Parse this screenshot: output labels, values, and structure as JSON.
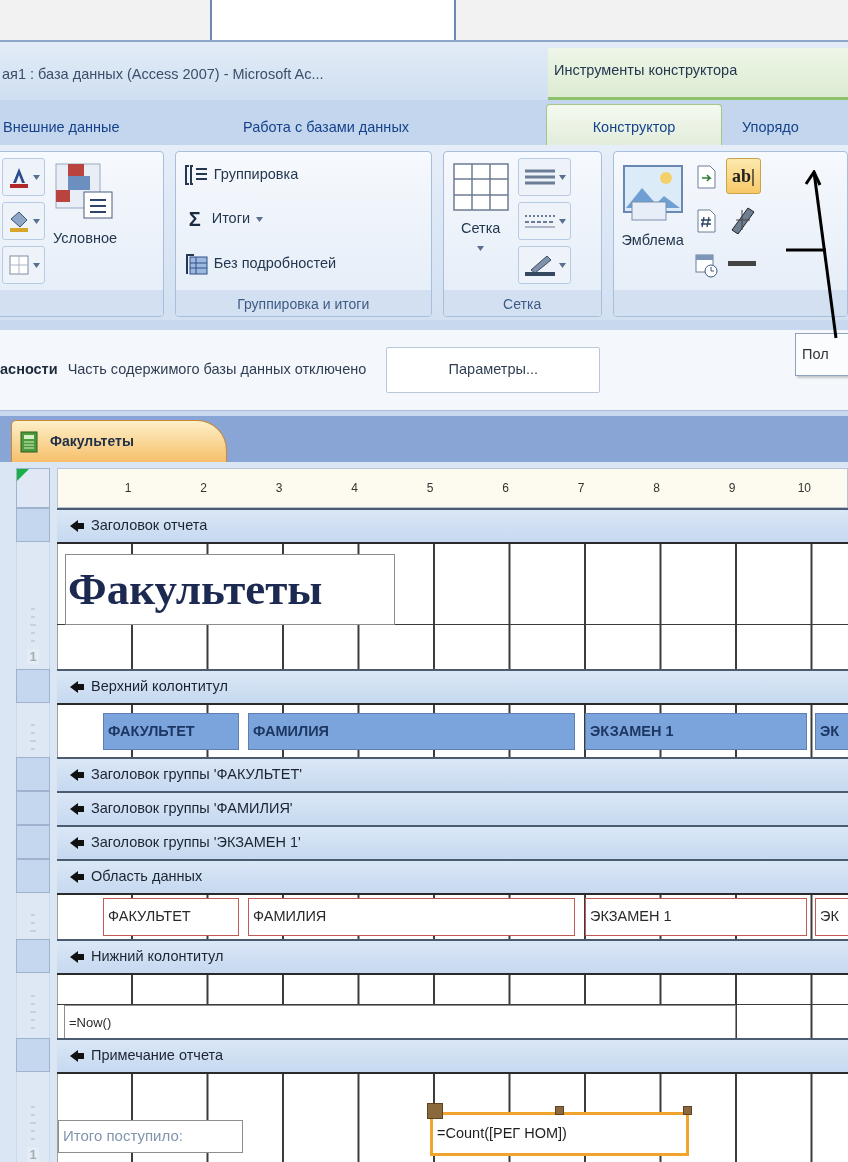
{
  "window": {
    "title": "ая1 : база данных (Access 2007) - Microsoft Ac..."
  },
  "context_header": {
    "label": "Инструменты конструктора"
  },
  "ribbon_tabs": [
    {
      "label": "Внешние данные",
      "selected": false
    },
    {
      "label": "Работа с базами данных",
      "selected": false
    },
    {
      "label": "Конструктор",
      "selected": true
    },
    {
      "label": "Упорядо",
      "selected": false
    }
  ],
  "ribbon_groups": [
    {
      "columns": [
        [
          {
            "kind": "icon-dropdown"
          },
          {
            "kind": "icon-dropdown"
          },
          {
            "kind": "icon-dropdown"
          }
        ],
        [
          {
            "kind": "large",
            "label": "Условное"
          }
        ]
      ]
    },
    {
      "label": "Группировка и итоги",
      "columns": [
        [
          {
            "kind": "small",
            "label": "Группировка"
          },
          {
            "kind": "small",
            "glyph": "Σ",
            "label": "Итоги",
            "dropdown": true
          },
          {
            "kind": "small",
            "label": "Без подробностей"
          }
        ]
      ]
    },
    {
      "label": "Сетка",
      "columns": [
        [
          {
            "kind": "large",
            "label": "Сетка",
            "dropdown": true
          }
        ],
        [
          {
            "kind": "icon-dropdown"
          },
          {
            "kind": "icon-dropdown"
          },
          {
            "kind": "icon-dropdown"
          }
        ]
      ]
    },
    {
      "columns": [
        [
          {
            "kind": "large",
            "label": "Эмблема"
          }
        ],
        [
          {
            "kind": "icon"
          },
          {
            "kind": "icon"
          },
          {
            "kind": "icon"
          }
        ],
        [
          {
            "kind": "toggle",
            "label": "ab|",
            "on": true
          },
          {
            "kind": "icon"
          },
          {
            "kind": "icon"
          }
        ]
      ]
    }
  ],
  "message_bar": {
    "title": "асности",
    "text": "Часть содержимого базы данных отключено",
    "button": "Параметры..."
  },
  "tooltip": {
    "text": "Пол"
  },
  "document_tabs": [
    {
      "label": "Факультеты",
      "selected": true
    }
  ],
  "ruler": {
    "numbers": [
      "1",
      "2",
      "3",
      "4",
      "5",
      "6",
      "7",
      "8",
      "9",
      "10"
    ]
  },
  "report_sections": [
    {
      "label": "Заголовок отчета",
      "ruler_label": "1",
      "controls": [
        {
          "kind": "title",
          "text": "Факультеты",
          "selected": false
        }
      ]
    },
    {
      "label": "Верхний колонтитул",
      "controls": [
        {
          "kind": "header-label",
          "text": "ФАКУЛЬТЕТ",
          "selected": false
        },
        {
          "kind": "header-label",
          "text": "ФАМИЛИЯ",
          "selected": false
        },
        {
          "kind": "header-label",
          "text": "ЭКЗАМЕН 1",
          "selected": false
        },
        {
          "kind": "header-label",
          "text": "ЭК",
          "selected": false
        }
      ]
    },
    {
      "label": "Заголовок группы 'ФАКУЛЬТЕТ'"
    },
    {
      "label": "Заголовок группы 'ФАМИЛИЯ'"
    },
    {
      "label": "Заголовок группы 'ЭКЗАМЕН 1'"
    },
    {
      "label": "Область данных",
      "controls": [
        {
          "kind": "textbox",
          "text": "ФАКУЛЬТЕТ",
          "selected": false
        },
        {
          "kind": "textbox",
          "text": "ФАМИЛИЯ",
          "selected": false
        },
        {
          "kind": "textbox",
          "text": "ЭКЗАМЕН 1",
          "selected": false
        },
        {
          "kind": "textbox",
          "text": "ЭК",
          "selected": false
        }
      ]
    },
    {
      "label": "Нижний колонтитул",
      "controls": [
        {
          "kind": "plain-textbox",
          "text": "=Now()",
          "selected": false
        }
      ]
    },
    {
      "label": "Примечание отчета",
      "ruler_label": "1",
      "controls": [
        {
          "kind": "label",
          "text": "Итого поступило:",
          "selected": false
        },
        {
          "kind": "plain-textbox",
          "text": "=Count([РЕГ НОМ])",
          "selected": true
        }
      ]
    }
  ]
}
